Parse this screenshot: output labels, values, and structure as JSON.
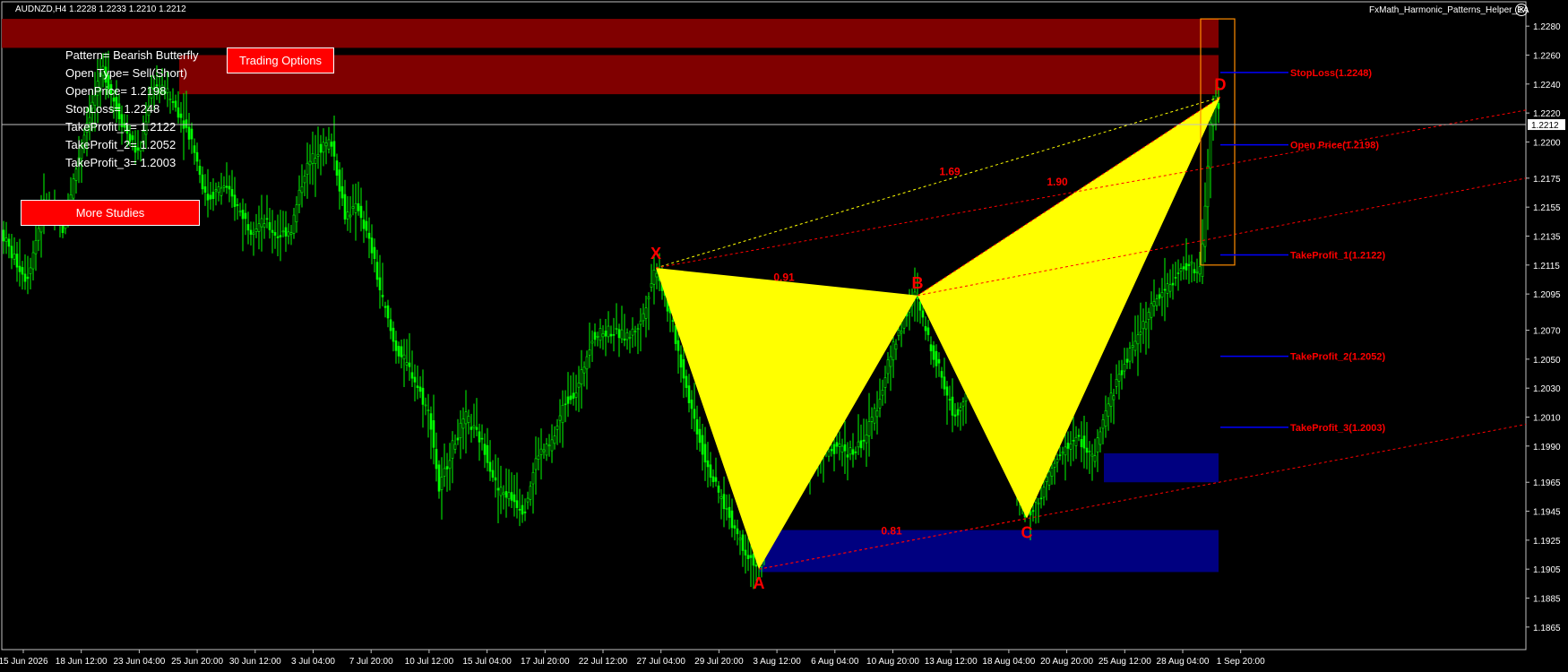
{
  "header": {
    "symbol_info": "AUDNZD,H4  1.2228 1.2233 1.2210 1.2212",
    "ea_name": "FxMath_Harmonic_Patterns_Helper_EA"
  },
  "panel": {
    "pattern": "Pattern= Bearish Butterfly",
    "open_type": "Open Type= Sell(Short)",
    "open_price": "OpenPrice= 1.2198",
    "stop_loss": "StopLoss= 1.2248",
    "take_profit_1": "TakeProfit_1= 1.2122",
    "take_profit_2": "TakeProfit_2= 1.2052",
    "take_profit_3": "TakeProfit_3= 1.2003",
    "trading_options_label": "Trading Options",
    "more_studies_label": "More Studies"
  },
  "colors": {
    "background": "#000000",
    "candles": "#00ff00",
    "pattern_fill": "#ffff00",
    "pattern_label": "#ff0000",
    "sell_zone": "#800000",
    "buy_zone": "#000080",
    "level_line": "#0000ff",
    "level_text": "#ff0000",
    "bid_line": "#c0c0c0"
  },
  "chart_data": {
    "type": "candlestick",
    "title": "AUDNZD,H4",
    "ylim": [
      1.1855,
      1.229
    ],
    "y_ticks": [
      "1.2280",
      "1.2260",
      "1.2240",
      "1.2220",
      "1.2200",
      "1.2175",
      "1.2155",
      "1.2135",
      "1.2115",
      "1.2095",
      "1.2070",
      "1.2050",
      "1.2030",
      "1.2010",
      "1.1990",
      "1.1965",
      "1.1945",
      "1.1925",
      "1.1905",
      "1.1885",
      "1.1865"
    ],
    "x_ticks": [
      "15 Jun 2026",
      "18 Jun 12:00",
      "23 Jun 04:00",
      "25 Jun 20:00",
      "30 Jun 12:00",
      "3 Jul 04:00",
      "7 Jul 20:00",
      "10 Jul 12:00",
      "15 Jul 04:00",
      "17 Jul 20:00",
      "22 Jul 12:00",
      "27 Jul 04:00",
      "29 Jul 20:00",
      "3 Aug 12:00",
      "6 Aug 04:00",
      "10 Aug 20:00",
      "13 Aug 12:00",
      "18 Aug 04:00",
      "20 Aug 20:00",
      "25 Aug 12:00",
      "28 Aug 04:00",
      "1 Sep 20:00"
    ],
    "current_price": "1.2212",
    "price_path": [
      [
        0,
        1.214
      ],
      [
        15,
        1.212
      ],
      [
        30,
        1.2105
      ],
      [
        50,
        1.216
      ],
      [
        70,
        1.214
      ],
      [
        95,
        1.221
      ],
      [
        115,
        1.225
      ],
      [
        135,
        1.2215
      ],
      [
        155,
        1.219
      ],
      [
        170,
        1.224
      ],
      [
        185,
        1.2235
      ],
      [
        200,
        1.222
      ],
      [
        215,
        1.22
      ],
      [
        230,
        1.216
      ],
      [
        250,
        1.217
      ],
      [
        265,
        1.2155
      ],
      [
        280,
        1.214
      ],
      [
        295,
        1.2145
      ],
      [
        310,
        1.2135
      ],
      [
        325,
        1.214
      ],
      [
        340,
        1.218
      ],
      [
        355,
        1.2195
      ],
      [
        370,
        1.22
      ],
      [
        385,
        1.215
      ],
      [
        400,
        1.2155
      ],
      [
        415,
        1.2125
      ],
      [
        425,
        1.2095
      ],
      [
        440,
        1.206
      ],
      [
        460,
        1.204
      ],
      [
        480,
        1.201
      ],
      [
        490,
        1.196
      ],
      [
        505,
        1.199
      ],
      [
        520,
        1.201
      ],
      [
        540,
        1.199
      ],
      [
        555,
        1.196
      ],
      [
        570,
        1.1955
      ],
      [
        585,
        1.1945
      ],
      [
        600,
        1.1985
      ],
      [
        615,
        1.199
      ],
      [
        630,
        1.202
      ],
      [
        645,
        1.203
      ],
      [
        660,
        1.2065
      ],
      [
        680,
        1.207
      ],
      [
        700,
        1.2065
      ],
      [
        715,
        1.2075
      ],
      [
        732,
        1.2115
      ],
      [
        750,
        1.2075
      ],
      [
        770,
        1.202
      ],
      [
        785,
        1.1985
      ],
      [
        800,
        1.196
      ],
      [
        815,
        1.194
      ],
      [
        830,
        1.192
      ],
      [
        847,
        1.1905
      ],
      [
        860,
        1.196
      ],
      [
        870,
        1.1985
      ],
      [
        885,
        1.2005
      ],
      [
        900,
        1.198
      ],
      [
        920,
        1.1985
      ],
      [
        935,
        1.199
      ],
      [
        950,
        1.1985
      ],
      [
        965,
        1.1995
      ],
      [
        980,
        1.202
      ],
      [
        995,
        1.2055
      ],
      [
        1010,
        1.208
      ],
      [
        1022,
        1.2095
      ],
      [
        1035,
        1.2065
      ],
      [
        1050,
        1.204
      ],
      [
        1065,
        1.201
      ],
      [
        1080,
        1.203
      ],
      [
        1097,
        1.208
      ],
      [
        1110,
        1.2055
      ],
      [
        1120,
        1.201
      ],
      [
        1135,
        1.196
      ],
      [
        1146,
        1.194
      ],
      [
        1160,
        1.1955
      ],
      [
        1175,
        1.1975
      ],
      [
        1190,
        1.199
      ],
      [
        1205,
        1.1995
      ],
      [
        1220,
        1.198
      ],
      [
        1235,
        1.2015
      ],
      [
        1250,
        1.204
      ],
      [
        1265,
        1.206
      ],
      [
        1280,
        1.208
      ],
      [
        1295,
        1.2095
      ],
      [
        1310,
        1.2105
      ],
      [
        1325,
        1.2115
      ],
      [
        1340,
        1.211
      ],
      [
        1352,
        1.222
      ],
      [
        1358,
        1.2232
      ],
      [
        1362,
        1.2212
      ]
    ],
    "pattern": {
      "name": "Bearish Butterfly",
      "points": [
        {
          "label": "X",
          "value": 1.2113
        },
        {
          "label": "A",
          "value": 1.1905
        },
        {
          "label": "B",
          "value": 1.2094
        },
        {
          "label": "C",
          "value": 1.194
        },
        {
          "label": "D",
          "value": 1.2231
        }
      ],
      "ratios": [
        "0.91",
        "0.81",
        "1.69",
        "1.90"
      ]
    },
    "levels": [
      {
        "label": "StopLoss(1.2248)",
        "value": 1.2248
      },
      {
        "label": "Open Price(1.2198)",
        "value": 1.2198
      },
      {
        "label": "TakeProfit_1(1.2122)",
        "value": 1.2122
      },
      {
        "label": "TakeProfit_2(1.2052)",
        "value": 1.2052
      },
      {
        "label": "TakeProfit_3(1.2003)",
        "value": 1.2003
      }
    ],
    "zones": [
      {
        "kind": "sell",
        "from": 1.2265,
        "to": 1.2285
      },
      {
        "kind": "sell",
        "from": 1.2233,
        "to": 1.226
      },
      {
        "kind": "buy",
        "from": 1.1965,
        "to": 1.1985
      },
      {
        "kind": "buy",
        "from": 1.1903,
        "to": 1.1932
      }
    ],
    "grid": false
  }
}
